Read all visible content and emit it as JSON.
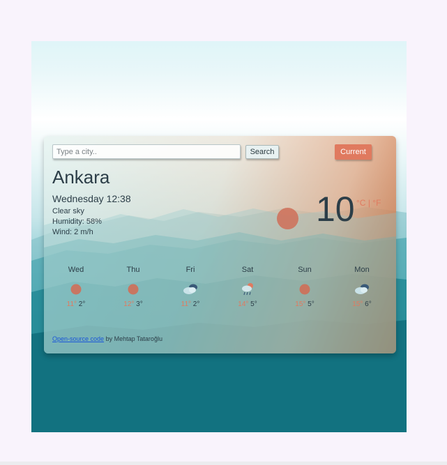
{
  "search": {
    "placeholder": "Type a city..",
    "button_label": "Search",
    "current_label": "Current"
  },
  "weather": {
    "city": "Ankara",
    "datetime": "Wednesday 12:38",
    "description": "Clear sky",
    "humidity": "Humidity: 58%",
    "wind": "Wind: 2 m/h",
    "temperature": "10",
    "unit_celsius": "°C",
    "unit_separator": "|",
    "unit_fahrenheit": "°F",
    "icon": "sun-icon"
  },
  "forecast": [
    {
      "day": "Wed",
      "icon": "sun-icon",
      "max": "11°",
      "min": "2°"
    },
    {
      "day": "Thu",
      "icon": "sun-icon",
      "max": "12°",
      "min": "3°"
    },
    {
      "day": "Fri",
      "icon": "cloud-icon",
      "max": "11°",
      "min": "2°"
    },
    {
      "day": "Sat",
      "icon": "rain-cloud-icon",
      "max": "14°",
      "min": "5°"
    },
    {
      "day": "Sun",
      "icon": "sun-icon",
      "max": "15°",
      "min": "5°"
    },
    {
      "day": "Mon",
      "icon": "cloud-icon",
      "max": "15°",
      "min": "6°"
    }
  ],
  "footer": {
    "link_text": "Open-source code",
    "credit": "by Mehtap Tataroğlu"
  },
  "colors": {
    "accent": "#e07a5f",
    "text": "#2c3e48",
    "link": "#1a56d8"
  }
}
